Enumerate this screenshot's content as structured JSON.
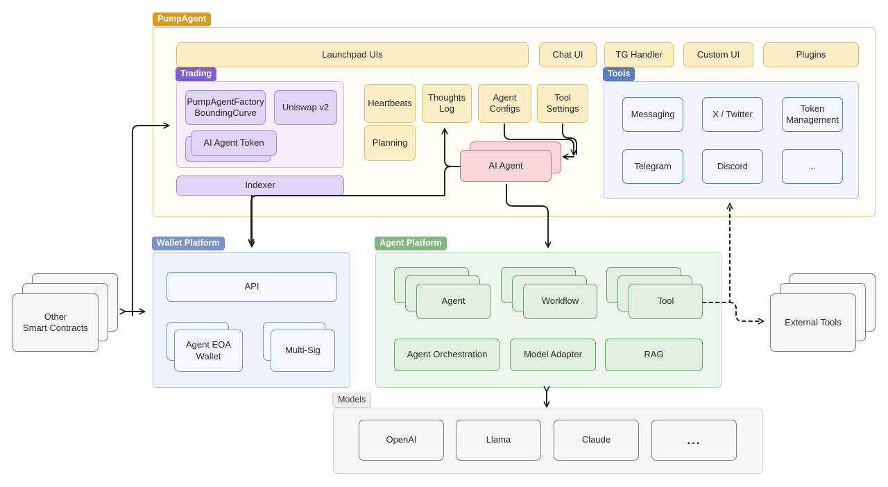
{
  "groups": {
    "pumpagent": {
      "label": "PumpAgent"
    },
    "trading": {
      "label": "Trading"
    },
    "tools": {
      "label": "Tools"
    },
    "wallet": {
      "label": "Wallet Platform"
    },
    "agent_platform": {
      "label": "Agent Platform"
    },
    "models": {
      "label": "Models"
    }
  },
  "pumpagent": {
    "top_row": [
      {
        "label": "Launchpad UIs"
      },
      {
        "label": "Chat UI"
      },
      {
        "label": "TG Handler"
      },
      {
        "label": "Custom UI"
      },
      {
        "label": "Plugins"
      }
    ],
    "trading_nodes": [
      {
        "label": "PumpAgentFactory\nBoundingCurve"
      },
      {
        "label": "Uniswap v2"
      },
      {
        "label": "AI Agent Token"
      }
    ],
    "indexer": {
      "label": "Indexer"
    },
    "middle_nodes": [
      {
        "label": "Heartbeats"
      },
      {
        "label": "Planning"
      },
      {
        "label": "Thoughts\nLog"
      },
      {
        "label": "Agent\nConfigs"
      },
      {
        "label": "Tool\nSettings"
      }
    ],
    "ai_agent": {
      "label": "AI Agent"
    },
    "tools_nodes": [
      {
        "label": "Messaging"
      },
      {
        "label": "X / Twitter"
      },
      {
        "label": "Token\nManagement"
      },
      {
        "label": "Telegram"
      },
      {
        "label": "Discord"
      },
      {
        "label": "..."
      }
    ]
  },
  "wallet_platform": {
    "api": {
      "label": "API"
    },
    "nodes": [
      {
        "label": "Agent EOA\nWallet"
      },
      {
        "label": "Multi-Sig"
      }
    ]
  },
  "agent_platform": {
    "stacks": [
      {
        "label": "Agent"
      },
      {
        "label": "Workflow"
      },
      {
        "label": "Tool"
      }
    ],
    "row2": [
      {
        "label": "Agent Orchestration"
      },
      {
        "label": "Model Adapter"
      },
      {
        "label": "RAG"
      }
    ]
  },
  "models": {
    "nodes": [
      {
        "label": "OpenAI"
      },
      {
        "label": "Llama"
      },
      {
        "label": "Claude"
      },
      {
        "label": "..."
      }
    ]
  },
  "external": {
    "smart_contracts": {
      "label": "Other\nSmart Contracts"
    },
    "external_tools": {
      "label": "External Tools"
    }
  },
  "colors": {
    "pumpagent_border": "#e2c88a",
    "pumpagent_label": "#d79b1e",
    "trading_label": "#7d5fd3",
    "tools_label": "#5a7ec0",
    "wallet_label": "#7b92c9",
    "agent_platform_label": "#82b783",
    "models_label": "#eeeeef",
    "ai_agent_fill": "#f7d7da",
    "arrow": "#1d1d1d"
  }
}
